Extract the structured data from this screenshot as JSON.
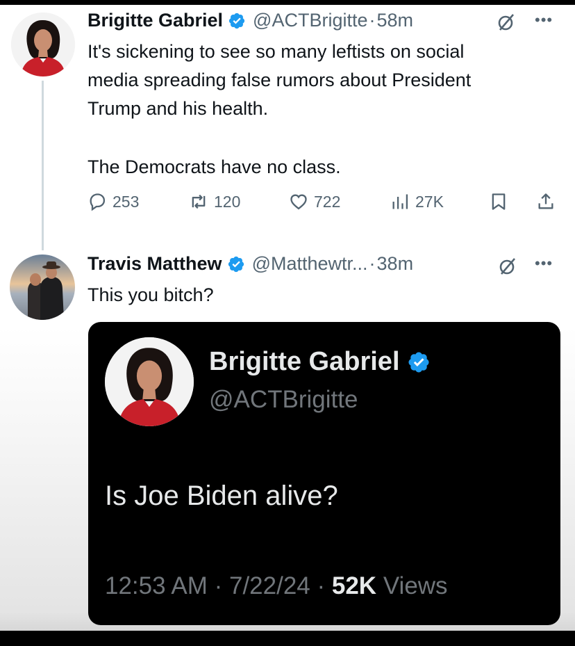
{
  "tweet1": {
    "name": "Brigitte Gabriel",
    "handle": "@ACTBrigitte",
    "sep": "·",
    "time": "58m",
    "lines": [
      "It's sickening to see so many leftists on social",
      "media spreading false rumors about President",
      "Trump and his health."
    ],
    "line2": "The Democrats have no class.",
    "actions": {
      "replies": "253",
      "reposts": "120",
      "likes": "722",
      "views": "27K"
    }
  },
  "tweet2": {
    "name": "Travis Matthew",
    "handle": "@Matthewtr...",
    "sep": "·",
    "time": "38m",
    "text": "This you bitch?"
  },
  "embed": {
    "name": "Brigitte Gabriel",
    "handle": "@ACTBrigitte",
    "text": "Is Joe Biden alive?",
    "timestamp": "12:53 AM · 7/22/24 · ",
    "views_count": "52K",
    "views_label": "Views"
  },
  "icons": {
    "verified": "verified-badge-icon",
    "grok": "grok-icon",
    "more": "more-options-icon",
    "reply": "reply-icon",
    "repost": "repost-icon",
    "like": "like-icon",
    "views": "views-icon",
    "bookmark": "bookmark-icon",
    "share": "share-icon"
  },
  "colors": {
    "verified_blue": "#1d9bf0",
    "secondary_text": "#536471",
    "primary_text": "#0f1419",
    "embed_bg": "#000000"
  }
}
